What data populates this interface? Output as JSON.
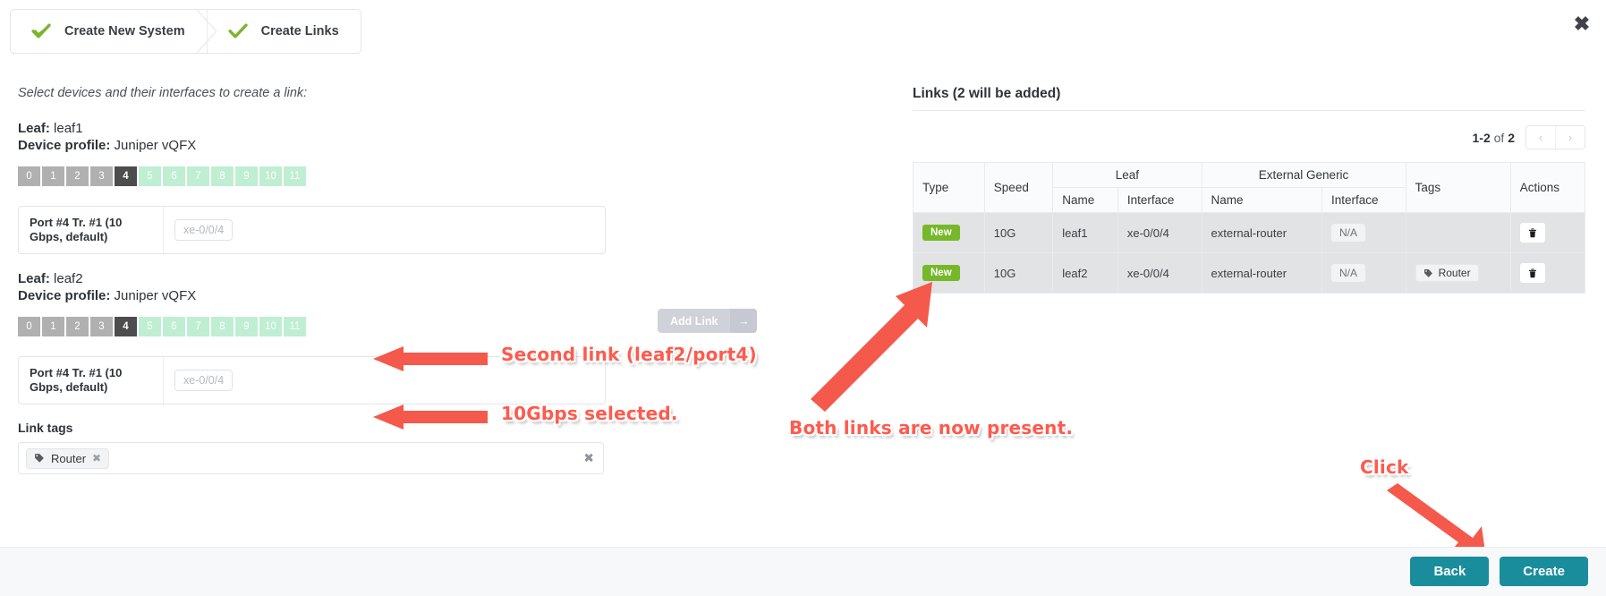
{
  "wizard": {
    "steps": [
      {
        "label": "Create New System",
        "state": "complete",
        "icon": "check-icon"
      },
      {
        "label": "Create Links",
        "state": "complete",
        "icon": "check-icon"
      }
    ]
  },
  "close_button": {
    "icon": "close-icon",
    "glyph": "✖"
  },
  "left": {
    "helper_text": "Select devices and their interfaces to create a link:",
    "devices": [
      {
        "leaf_label": "Leaf:",
        "leaf_name": "leaf1",
        "profile_label": "Device profile:",
        "profile_name": "Juniper vQFX",
        "ports": [
          {
            "n": "0",
            "state": "used"
          },
          {
            "n": "1",
            "state": "used"
          },
          {
            "n": "2",
            "state": "used"
          },
          {
            "n": "3",
            "state": "used"
          },
          {
            "n": "4",
            "state": "selected"
          },
          {
            "n": "5",
            "state": "free"
          },
          {
            "n": "6",
            "state": "free"
          },
          {
            "n": "7",
            "state": "free"
          },
          {
            "n": "8",
            "state": "free"
          },
          {
            "n": "9",
            "state": "free"
          },
          {
            "n": "10",
            "state": "free"
          },
          {
            "n": "11",
            "state": "free"
          }
        ],
        "iface_label": "Port #4 Tr. #1 (10 Gbps, default)",
        "iface_value": "xe-0/0/4"
      },
      {
        "leaf_label": "Leaf:",
        "leaf_name": "leaf2",
        "profile_label": "Device profile:",
        "profile_name": "Juniper vQFX",
        "ports": [
          {
            "n": "0",
            "state": "used"
          },
          {
            "n": "1",
            "state": "used"
          },
          {
            "n": "2",
            "state": "used"
          },
          {
            "n": "3",
            "state": "used"
          },
          {
            "n": "4",
            "state": "selected"
          },
          {
            "n": "5",
            "state": "free"
          },
          {
            "n": "6",
            "state": "free"
          },
          {
            "n": "7",
            "state": "free"
          },
          {
            "n": "8",
            "state": "free"
          },
          {
            "n": "9",
            "state": "free"
          },
          {
            "n": "10",
            "state": "free"
          },
          {
            "n": "11",
            "state": "free"
          }
        ],
        "iface_label": "Port #4 Tr. #1 (10 Gbps, default)",
        "iface_value": "xe-0/0/4"
      }
    ],
    "link_tags": {
      "title": "Link tags",
      "chips": [
        {
          "label": "Router",
          "icon": "tag-icon",
          "remove_icon": "x-icon"
        }
      ],
      "clear_icon": "x-icon"
    }
  },
  "add_link_button": {
    "label": "Add Link",
    "arrow_icon": "arrow-right-icon",
    "disabled": true
  },
  "right": {
    "title": "Links (2 will be added)",
    "pager": {
      "range": "1-2",
      "of_label": "of",
      "total": "2",
      "prev_icon": "chevron-left-icon",
      "next_icon": "chevron-right-icon"
    },
    "table": {
      "group_headers": [
        {
          "label": "Type"
        },
        {
          "label": "Speed"
        },
        {
          "label": "Leaf"
        },
        {
          "label": "External Generic"
        },
        {
          "label": "Tags"
        },
        {
          "label": "Actions"
        }
      ],
      "sub_headers": [
        {
          "label": "Name"
        },
        {
          "label": "Interface"
        },
        {
          "label": "Name"
        },
        {
          "label": "Interface"
        }
      ],
      "rows": [
        {
          "type": "New",
          "speed": "10G",
          "leaf_name": "leaf1",
          "leaf_interface": "xe-0/0/4",
          "ext_name": "external-router",
          "ext_interface": "N/A",
          "tags": [],
          "action_icon": "trash-icon"
        },
        {
          "type": "New",
          "speed": "10G",
          "leaf_name": "leaf2",
          "leaf_interface": "xe-0/0/4",
          "ext_name": "external-router",
          "ext_interface": "N/A",
          "tags": [
            "Router"
          ],
          "action_icon": "trash-icon"
        }
      ]
    }
  },
  "footer": {
    "back_label": "Back",
    "create_label": "Create"
  },
  "annotations": [
    {
      "text": "Second link (leaf2/port4)"
    },
    {
      "text": "10Gbps selected."
    },
    {
      "text": "Both links are now present."
    },
    {
      "text": "Click"
    }
  ],
  "colors": {
    "accent_teal": "#1a8d9c",
    "badge_green": "#76b82a",
    "port_free": "#bfeed3",
    "port_used": "#b0b0b0",
    "port_selected": "#4d4d4d",
    "annotation_red": "#ff5a4d",
    "check_green": "#7ab530"
  }
}
